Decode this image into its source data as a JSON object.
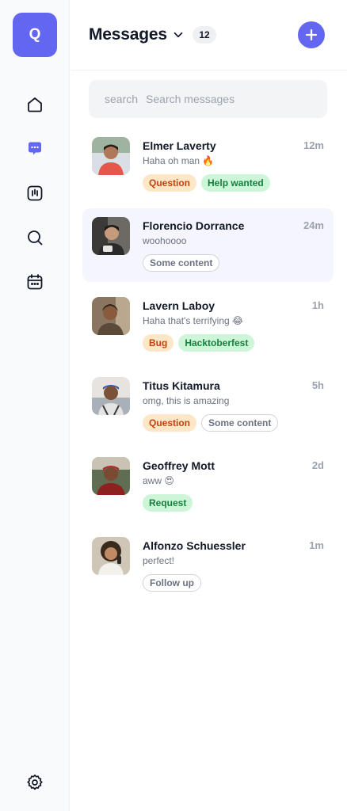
{
  "sidebar": {
    "logo_letter": "Q",
    "accent_color": "#6366f1",
    "nav": [
      {
        "icon": "home-icon",
        "active": false
      },
      {
        "icon": "messages-icon",
        "active": true
      },
      {
        "icon": "voice-icon",
        "active": false
      },
      {
        "icon": "search-icon",
        "active": false
      },
      {
        "icon": "calendar-icon",
        "active": false
      }
    ],
    "settings_icon": "gear-icon"
  },
  "header": {
    "title": "Messages",
    "count": "12",
    "add_icon": "plus-icon"
  },
  "search": {
    "keyword": "search",
    "placeholder": "Search messages"
  },
  "conversations": [
    {
      "name": "Elmer Laverty",
      "time": "12m",
      "preview": "Haha oh man 🔥",
      "tags": [
        {
          "label": "Question",
          "style": "orange"
        },
        {
          "label": "Help wanted",
          "style": "green"
        }
      ],
      "selected": false
    },
    {
      "name": "Florencio Dorrance",
      "time": "24m",
      "preview": "woohoooo",
      "tags": [
        {
          "label": "Some content",
          "style": "outline"
        }
      ],
      "selected": true
    },
    {
      "name": "Lavern Laboy",
      "time": "1h",
      "preview": "Haha that's terrifying 😂",
      "tags": [
        {
          "label": "Bug",
          "style": "orange"
        },
        {
          "label": "Hacktoberfest",
          "style": "green"
        }
      ],
      "selected": false
    },
    {
      "name": "Titus Kitamura",
      "time": "5h",
      "preview": "omg, this is amazing",
      "tags": [
        {
          "label": "Question",
          "style": "orange"
        },
        {
          "label": "Some content",
          "style": "outline"
        }
      ],
      "selected": false
    },
    {
      "name": "Geoffrey Mott",
      "time": "2d",
      "preview": "aww 😍",
      "tags": [
        {
          "label": "Request",
          "style": "green"
        }
      ],
      "selected": false
    },
    {
      "name": "Alfonzo Schuessler",
      "time": "1m",
      "preview": "perfect!",
      "tags": [
        {
          "label": "Follow up",
          "style": "outline"
        }
      ],
      "selected": false
    }
  ]
}
